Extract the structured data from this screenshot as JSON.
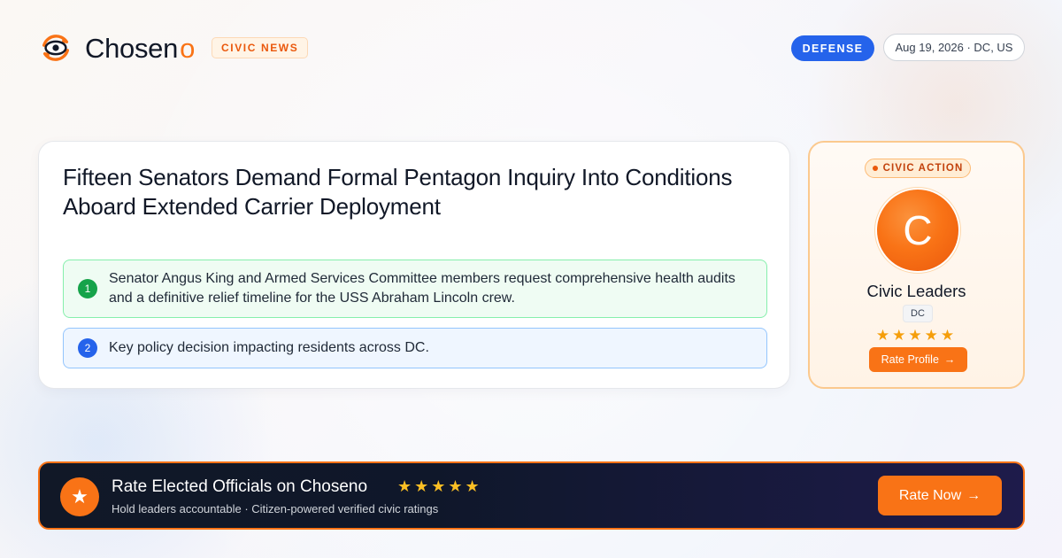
{
  "brand": {
    "name": "Chosen",
    "name_suffix": "o",
    "tag": "CIVIC NEWS",
    "logo_icon": "eye-refresh-icon",
    "accent_color": "#f97316"
  },
  "header": {
    "category": "DEFENSE",
    "date_location": "Aug 19, 2026 · DC, US"
  },
  "article": {
    "headline": "Fifteen Senators Demand Formal Pentagon Inquiry Into Conditions Aboard Extended Carrier Deployment",
    "points": [
      {
        "number": "1",
        "text": "Senator Angus King and Armed Services Committee members request comprehensive health audits and a definitive relief timeline for the USS Abraham Lincoln crew.",
        "color": "#16a34a"
      },
      {
        "number": "2",
        "text": "Key policy decision impacting residents across DC.",
        "color": "#2563eb"
      }
    ]
  },
  "side_card": {
    "badge": "CIVIC ACTION",
    "avatar_letter": "C",
    "name": "Civic Leaders",
    "state": "DC",
    "stars": "★★★★★",
    "rating": 5,
    "button_label": "Rate Profile",
    "button_arrow": "→"
  },
  "banner": {
    "icon": "star-icon",
    "icon_glyph": "★",
    "title": "Rate Elected Officials on Choseno",
    "stars": "★★★★★",
    "rating": 5,
    "subtitle": "Hold leaders accountable · Citizen-powered verified civic ratings",
    "button_label": "Rate Now",
    "button_arrow": "→"
  }
}
